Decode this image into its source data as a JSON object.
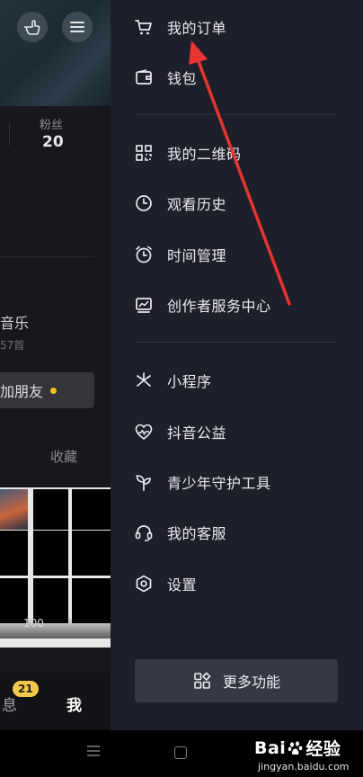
{
  "profile": {
    "stat_label": "粉丝",
    "stat_value": "20",
    "music_title": "音乐",
    "music_sub": "57首",
    "add_friend_label": "加朋友",
    "favorites_tab": "收藏",
    "grid_caption": "100"
  },
  "bottom_nav": {
    "messages_label": "息",
    "messages_badge": "21",
    "me_label": "我"
  },
  "drawer": {
    "items": [
      {
        "label": "我的订单",
        "icon": "cart-icon"
      },
      {
        "label": "钱包",
        "icon": "wallet-icon"
      },
      {
        "label": "我的二维码",
        "icon": "qrcode-icon"
      },
      {
        "label": "观看历史",
        "icon": "clock-icon"
      },
      {
        "label": "时间管理",
        "icon": "alarm-icon"
      },
      {
        "label": "创作者服务中心",
        "icon": "chart-icon"
      },
      {
        "label": "小程序",
        "icon": "mini-program-icon"
      },
      {
        "label": "抖音公益",
        "icon": "charity-heart-icon"
      },
      {
        "label": "青少年守护工具",
        "icon": "sprout-icon"
      },
      {
        "label": "我的客服",
        "icon": "headset-icon"
      },
      {
        "label": "设置",
        "icon": "settings-hexagon-icon"
      }
    ],
    "more_label": "更多功能"
  },
  "watermark": {
    "brand_left": "Bai",
    "brand_right": "经验",
    "url": "jingyan.baidu.com"
  },
  "colors": {
    "drawer_bg": "#1d1f2a",
    "accent_yellow": "#f2c94c",
    "annotation_red": "#e8352f"
  }
}
